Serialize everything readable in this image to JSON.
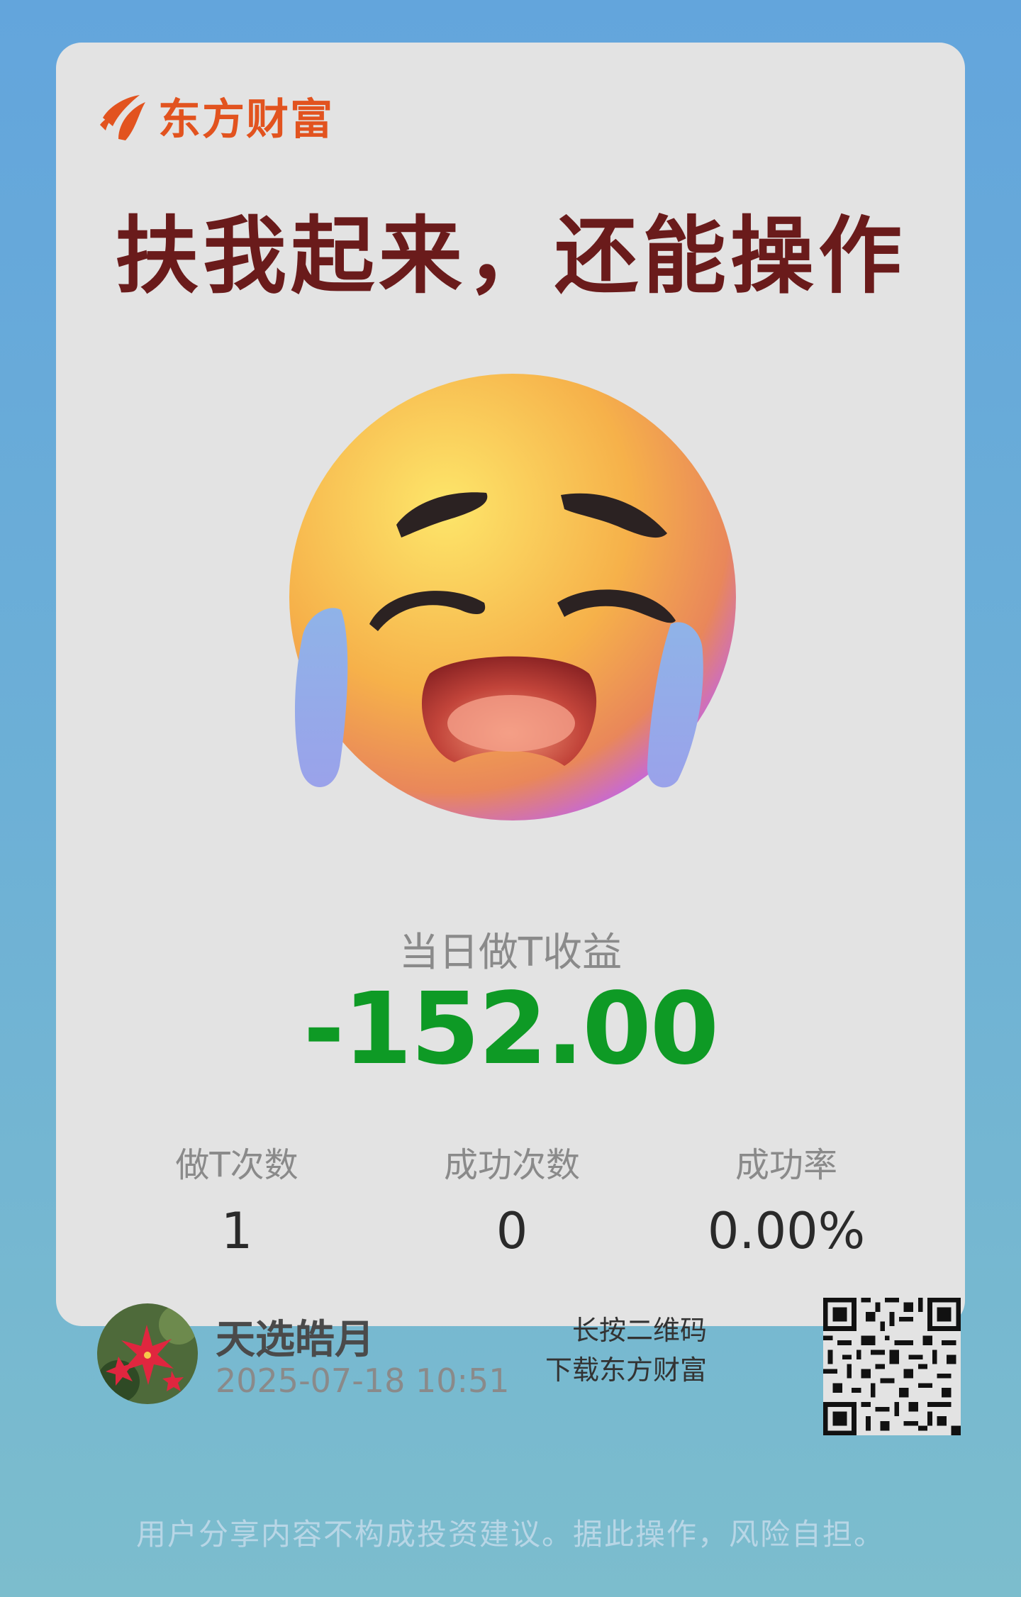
{
  "brand": {
    "name": "东方财富",
    "accent_color": "#e2531f"
  },
  "card": {
    "headline": "扶我起来，还能操作",
    "emoji_icon": "loudly-crying-face-icon",
    "profit": {
      "label": "当日做T收益",
      "value": "-152.00",
      "color": "#0e9a25"
    },
    "stats": [
      {
        "label": "做T次数",
        "value": "1"
      },
      {
        "label": "成功次数",
        "value": "0"
      },
      {
        "label": "成功率",
        "value": "0.00%"
      }
    ],
    "user": {
      "name": "天选皓月",
      "datetime": "2025-07-18 10:51",
      "avatar_icon": "red-flower-avatar"
    },
    "qr": {
      "line1": "长按二维码",
      "line2": "下载东方财富",
      "icon": "qr-code-icon"
    }
  },
  "disclaimer": "用户分享内容不构成投资建议。据此操作，风险自担。"
}
